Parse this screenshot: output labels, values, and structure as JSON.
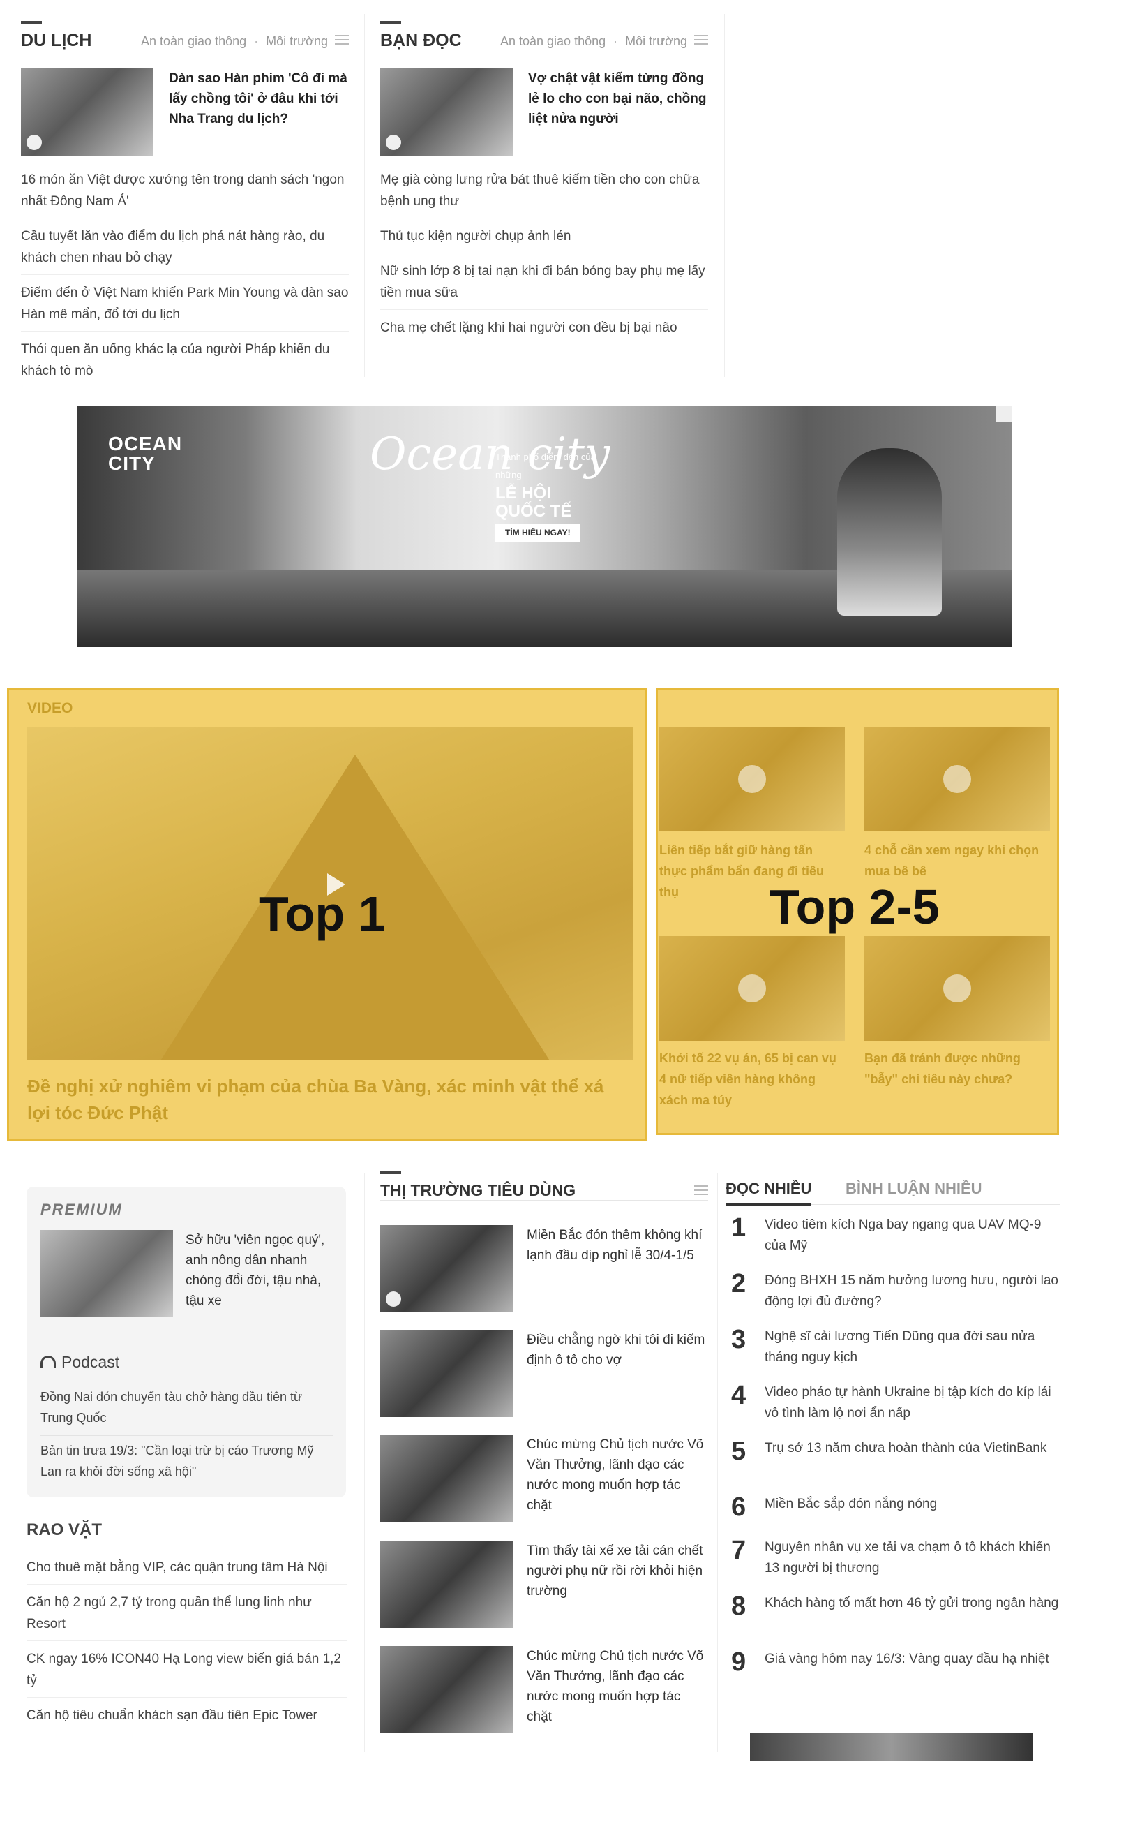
{
  "du_lich": {
    "title": "DU LỊCH",
    "subcategories": [
      "An toàn giao thông",
      "Môi trường"
    ],
    "featured_title": "Dàn sao Hàn phim 'Cô đi mà lấy chồng tôi' ở đâu khi tới Nha Trang du lịch?",
    "items": [
      "16 món ăn Việt được xướng tên trong danh sách 'ngon nhất Đông Nam Á'",
      "Cầu tuyết lăn vào điểm du lịch phá nát hàng rào, du khách chen nhau bỏ chạy",
      "Điểm đến ở Việt Nam khiến Park Min Young và dàn sao Hàn mê mẩn, đổ tới du lịch",
      "Thói quen ăn uống khác lạ của người Pháp khiến du khách tò mò"
    ]
  },
  "ban_doc": {
    "title": "BẠN ĐỌC",
    "subcategories": [
      "An toàn giao thông",
      "Môi trường"
    ],
    "featured_title": "Vợ chật vật kiếm từng đồng lẻ lo cho con bại não, chồng liệt nửa người",
    "items": [
      "Mẹ già còng lưng rửa bát thuê kiếm tiền cho con chữa bệnh ung thư",
      "Thủ tục kiện người chụp ảnh lén",
      "Nữ sinh lớp 8 bị tai nạn khi đi bán bóng bay phụ mẹ lấy tiền mua sữa",
      "Cha mẹ chết lặng khi hai người con đều bị bại não"
    ]
  },
  "banner": {
    "brand": "OCEAN CITY",
    "script_title": "Ocean city",
    "subline": "Thành phố điểm đến của những",
    "headline": "LỄ HỘI QUỐC TẾ",
    "cta": "TÌM HIỂU NGAY!"
  },
  "video": {
    "label": "VIDEO",
    "overlay_main": "Top 1",
    "overlay_side": "Top 2-5",
    "main_caption": "Đề nghị xử nghiêm vi phạm của chùa Ba Vàng, xác minh vật thể xá lợi tóc Đức Phật",
    "side_items": [
      "Liên tiếp bắt giữ hàng tấn thực phẩm bẩn đang đi tiêu thụ",
      "4 chỗ cần xem ngay khi chọn mua bê bê",
      "Khởi tố 22 vụ án, 65 bị can vụ 4 nữ tiếp viên hàng không xách ma túy",
      "Bạn đã tránh được những \"bẫy\" chi tiêu này chưa?"
    ]
  },
  "premium": {
    "logo": "PREMIUM",
    "title": "Sở hữu 'viên ngọc quý', anh nông dân nhanh chóng đổi đời, tậu nhà, tậu xe",
    "podcast_label": "Podcast",
    "podcast_items": [
      "Đồng Nai đón chuyến tàu chở hàng đầu tiên từ Trung Quốc",
      "Bản tin trưa 19/3: \"Cần loại trừ bị cáo Trương Mỹ Lan ra khỏi đời sống xã hội\""
    ]
  },
  "rao_vat": {
    "title": "RAO VẶT",
    "items": [
      "Cho thuê mặt bằng VIP, các quận trung tâm Hà Nội",
      "Căn hộ 2 ngủ 2,7 tỷ trong quần thể lung linh như Resort",
      "CK ngay 16% ICON40 Hạ Long view biển giá bán 1,2 tỷ",
      "Căn hộ tiêu chuẩn khách sạn đầu tiên Epic Tower"
    ]
  },
  "thi_truong": {
    "title": "THỊ TRƯỜNG TIÊU DÙNG",
    "items": [
      "Miền Bắc đón thêm không khí lạnh đầu dịp nghỉ lễ 30/4-1/5",
      "Điều chẳng ngờ khi tôi đi kiểm định ô tô cho vợ",
      "Chúc mừng Chủ tịch nước Võ Văn Thưởng, lãnh đạo các nước mong muốn hợp tác chặt",
      "Tìm thấy tài xế xe tải cán chết người phụ nữ rồi rời khỏi hiện trường",
      "Chúc mừng Chủ tịch nước Võ Văn Thưởng, lãnh đạo các nước mong muốn hợp tác chặt"
    ]
  },
  "doc_nhieu": {
    "tab_active": "ĐỌC NHIỀU",
    "tab_other": "BÌNH LUẬN NHIỀU",
    "items": [
      {
        "rank": "1",
        "title": "Video tiêm kích Nga bay ngang qua UAV MQ-9 của Mỹ"
      },
      {
        "rank": "2",
        "title": "Đóng BHXH 15 năm hưởng lương hưu, người lao động lợi đủ đường?"
      },
      {
        "rank": "3",
        "title": "Nghệ sĩ cải lương Tiến Dũng qua đời sau nửa tháng nguy kịch"
      },
      {
        "rank": "4",
        "title": "Video pháo tự hành Ukraine bị tập kích do kíp lái vô tình làm lộ nơi ẩn nấp"
      },
      {
        "rank": "5",
        "title": "Trụ sở 13 năm chưa hoàn thành của VietinBank"
      },
      {
        "rank": "6",
        "title": "Miền Bắc sắp đón nắng nóng"
      },
      {
        "rank": "7",
        "title": "Nguyên nhân vụ xe tải va chạm ô tô khách khiến 13 người bị thương"
      },
      {
        "rank": "8",
        "title": "Khách hàng tố mất hơn 46 tỷ gửi trong ngân hàng"
      },
      {
        "rank": "9",
        "title": "Giá vàng hôm nay 16/3: Vàng quay đầu hạ nhiệt"
      }
    ]
  }
}
